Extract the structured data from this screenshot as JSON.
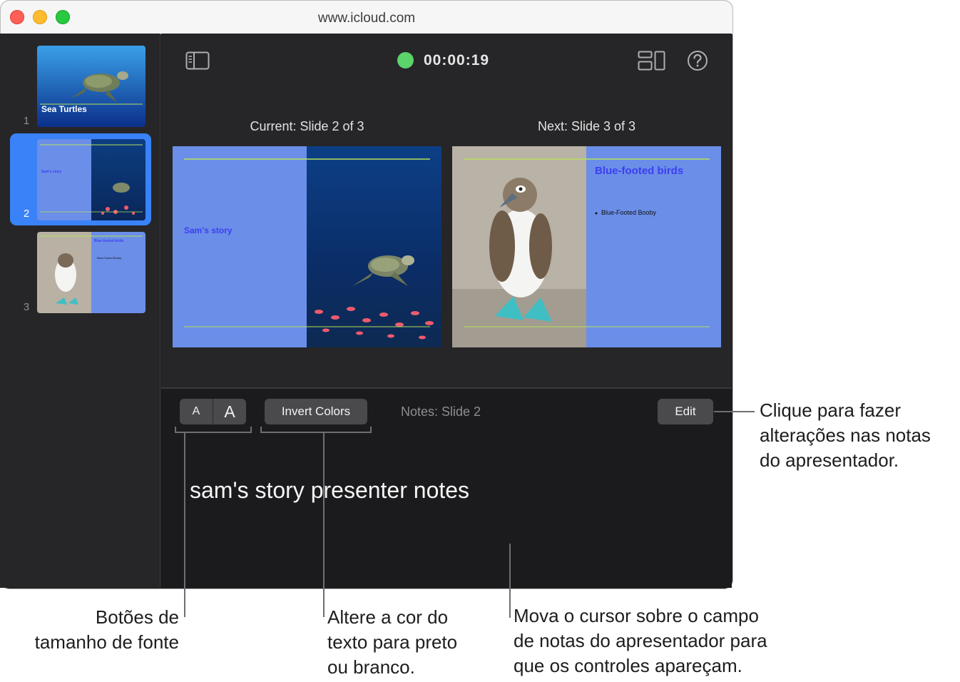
{
  "window": {
    "url": "www.icloud.com"
  },
  "toolbar": {
    "sidebar_toggle_icon": "sidebar-icon",
    "timer": "00:00:19",
    "layout_icon": "layout-icon",
    "help_icon": "help-icon"
  },
  "sidebar": {
    "slides": [
      {
        "number": "1",
        "title": "Sea Turtles",
        "selected": false
      },
      {
        "number": "2",
        "title": "Sam's story",
        "selected": true
      },
      {
        "number": "3",
        "title": "Blue-footed birds",
        "bullet": "Blue-Footed Booby",
        "selected": false
      }
    ]
  },
  "current": {
    "label": "Current: Slide 2 of 3",
    "slide_title": "Sam's story"
  },
  "next": {
    "label": "Next: Slide 3 of 3",
    "slide_title": "Blue-footed birds",
    "bullet": "Blue-Footed Booby"
  },
  "notes": {
    "font_small": "A",
    "font_large": "A",
    "invert_label": "Invert Colors",
    "title": "Notes: Slide 2",
    "edit_label": "Edit",
    "text": "sam's story presenter notes"
  },
  "callouts": {
    "edit_line1": "Clique para fazer",
    "edit_line2": "alterações nas notas",
    "edit_line3": "do apresentador.",
    "font_line1": "Botões de",
    "font_line2": "tamanho de fonte",
    "invert_line1": "Altere a cor do",
    "invert_line2": "texto para preto",
    "invert_line3": "ou branco.",
    "hover_line1": "Mova o cursor sobre o campo",
    "hover_line2": "de notas do apresentador para",
    "hover_line3": "que os controles apareçam."
  },
  "colors": {
    "slide_blue": "#6b8ee8",
    "title_blue": "#3c3ff0",
    "accent_green": "#b6e05a",
    "timer_green": "#5bd46b",
    "selection": "#3a82f7"
  }
}
